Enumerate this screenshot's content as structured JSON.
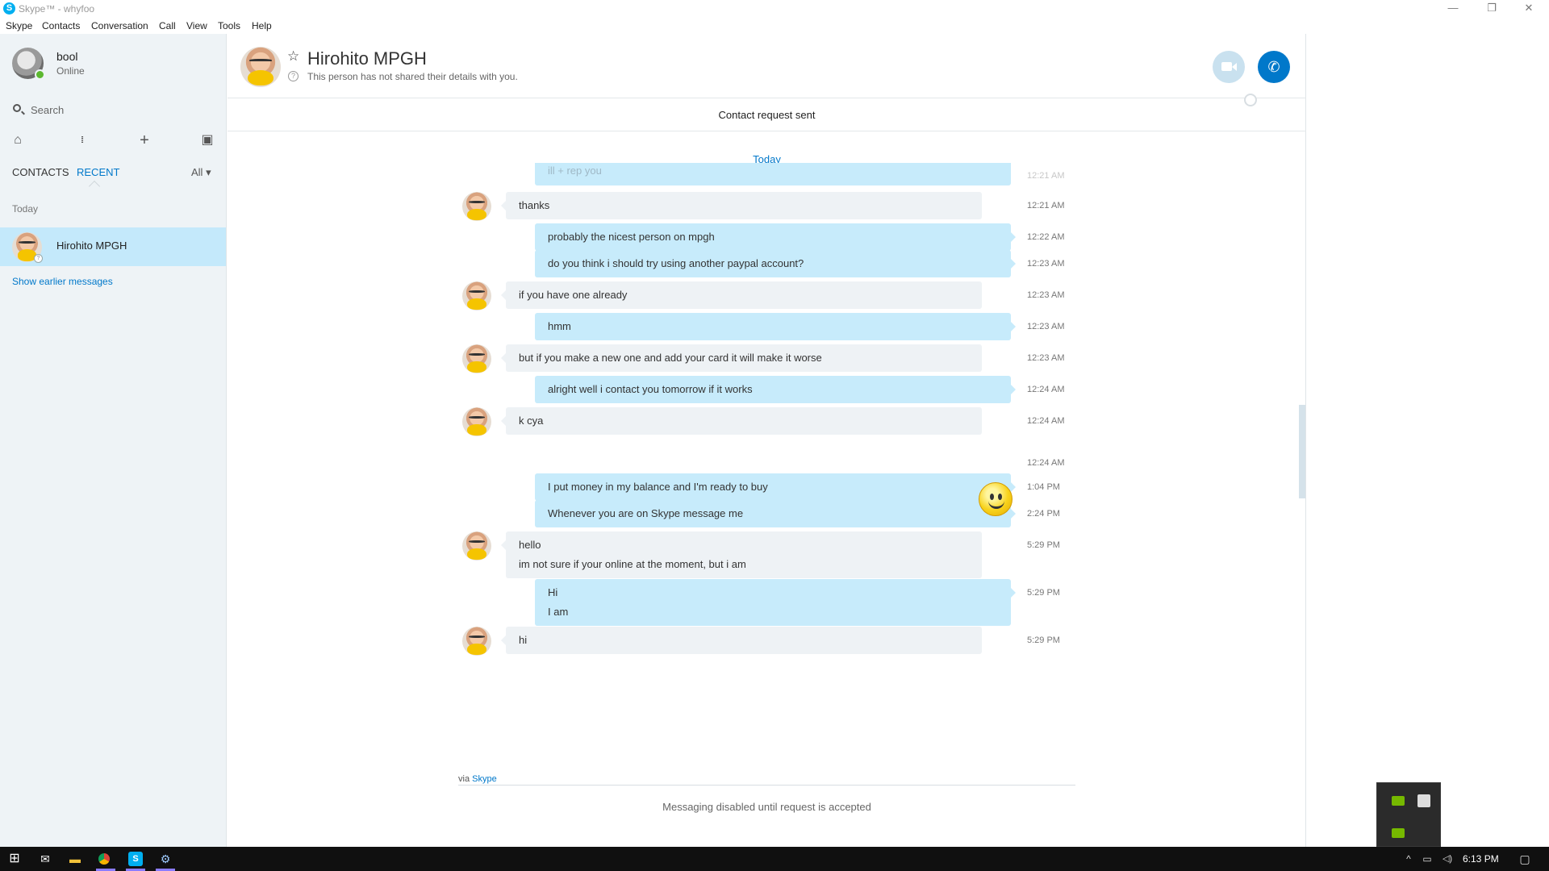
{
  "window": {
    "title": "Skype™ - whyfoo",
    "minimize_glyph": "—",
    "restore_glyph": "❐",
    "close_glyph": "✕"
  },
  "menu": [
    "Skype",
    "Contacts",
    "Conversation",
    "Call",
    "View",
    "Tools",
    "Help"
  ],
  "sidebar": {
    "user_name": "bool",
    "user_status": "Online",
    "search_placeholder": "Search",
    "tools": [
      {
        "icon": "home-icon",
        "glyph": "⌂"
      },
      {
        "icon": "dialpad-icon",
        "glyph": "⁞⁞"
      },
      {
        "icon": "add-icon",
        "glyph": "+"
      },
      {
        "icon": "contact-card-icon",
        "glyph": "▣"
      }
    ],
    "tab_contacts": "CONTACTS",
    "tab_recent": "RECENT",
    "filter_label": "All",
    "filter_chevron": "▾",
    "section_today": "Today",
    "recent_contact": "Hirohito MPGH",
    "show_earlier": "Show earlier messages"
  },
  "header": {
    "star_glyph": "☆",
    "contact_name": "Hirohito MPGH",
    "info_glyph": "?",
    "info_text": "This person has not shared their details with you.",
    "call_glyph": "✆"
  },
  "banner": {
    "text": "Contact request sent"
  },
  "conversation": {
    "date_label": "Today",
    "partial_top": {
      "text": "ill + rep you",
      "time": "12:21 AM"
    },
    "messages": [
      {
        "dir": "in",
        "lines": [
          "thanks"
        ],
        "time": "12:21 AM"
      },
      {
        "dir": "out",
        "lines": [
          "probably the nicest person on mpgh"
        ],
        "time": "12:22 AM"
      },
      {
        "dir": "out",
        "lines": [
          "do you think i should try using another paypal account?"
        ],
        "time": "12:23 AM"
      },
      {
        "dir": "in",
        "lines": [
          "if you have one already"
        ],
        "time": "12:23 AM"
      },
      {
        "dir": "out",
        "lines": [
          "hmm"
        ],
        "time": "12:23 AM"
      },
      {
        "dir": "in",
        "lines": [
          "but if you make a new one and add your card it will make it worse"
        ],
        "time": "12:23 AM"
      },
      {
        "dir": "out",
        "lines": [
          "alright well i contact you tomorrow if it works"
        ],
        "time": "12:24 AM"
      },
      {
        "dir": "in",
        "lines": [
          "k cya"
        ],
        "time": "12:24 AM"
      },
      {
        "dir": "emoji",
        "lines": [],
        "time": "12:24 AM",
        "icon": "smiley-emoticon-icon"
      },
      {
        "dir": "out",
        "lines": [
          "I put money in my balance and I'm ready to buy"
        ],
        "time": "1:04 PM"
      },
      {
        "dir": "out",
        "lines": [
          "Whenever you are on Skype message me"
        ],
        "time": "2:24 PM"
      },
      {
        "dir": "in",
        "lines": [
          "hello",
          "im not sure if your online at the moment, but i am"
        ],
        "time": "5:29 PM"
      },
      {
        "dir": "out",
        "lines": [
          "Hi",
          "I am"
        ],
        "time": "5:29 PM"
      },
      {
        "dir": "in",
        "lines": [
          "hi"
        ],
        "time": "5:29 PM"
      }
    ]
  },
  "footer": {
    "via_prefix": "via",
    "via_link": "Skype",
    "disabled_note": "Messaging disabled until request is accepted"
  },
  "taskbar": {
    "start_glyph": "⊞",
    "clock": "6:13 PM",
    "tray_glyphs": [
      "^",
      "▭",
      "◁)"
    ]
  },
  "colors": {
    "accent": "#0078ca",
    "incoming_bubble": "#eef2f5",
    "outgoing_bubble": "#c7ebfb",
    "selected_row": "#c4e9fb",
    "sidebar_bg": "#eef3f6",
    "online": "#5cb830"
  }
}
